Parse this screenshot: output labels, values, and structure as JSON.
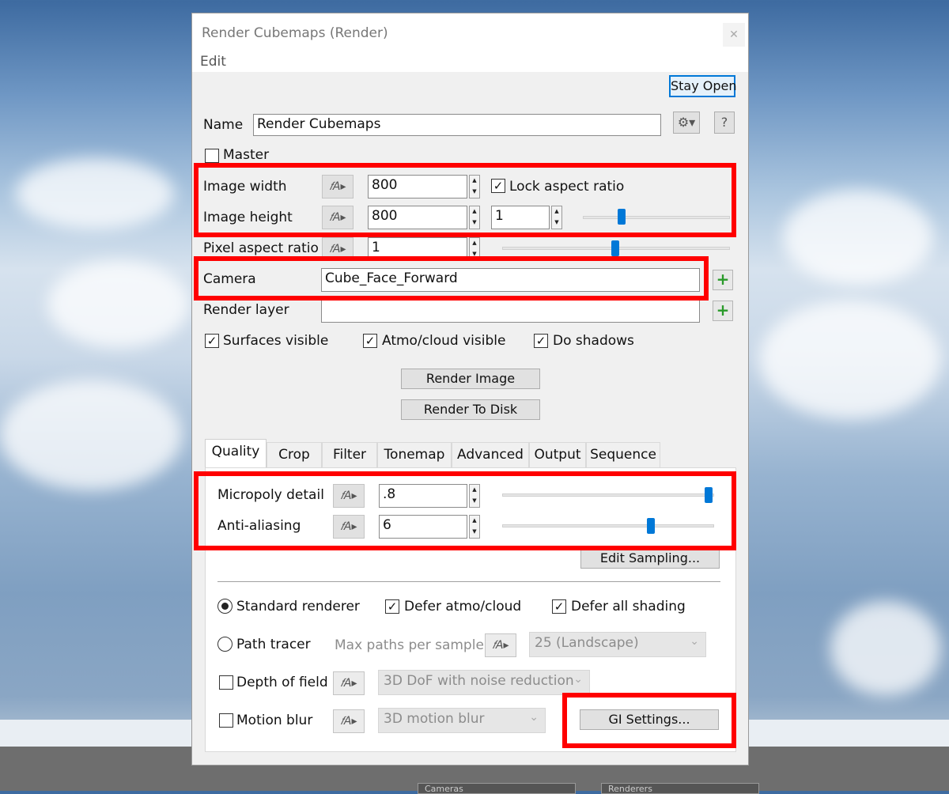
{
  "window": {
    "title": "Render Cubemaps    (Render)",
    "menu_edit": "Edit",
    "close_glyph": "✕"
  },
  "toolbar": {
    "stay_open": "Stay Open",
    "gear_glyph": "⚙▾",
    "help": "?"
  },
  "name": {
    "label": "Name",
    "value": "Render Cubemaps"
  },
  "master": {
    "label": "Master",
    "checked": false
  },
  "image_width": {
    "label": "Image width",
    "value": "800"
  },
  "lock_aspect": {
    "label": "Lock aspect ratio",
    "checked": true
  },
  "image_height": {
    "label": "Image height",
    "value": "800",
    "ratio_value": "1"
  },
  "pixel_aspect": {
    "label": "Pixel aspect ratio",
    "value": "1"
  },
  "camera": {
    "label": "Camera",
    "value": "Cube_Face_Forward"
  },
  "render_layer": {
    "label": "Render layer",
    "value": ""
  },
  "visibility": {
    "surfaces": {
      "label": "Surfaces visible",
      "checked": true
    },
    "atmo": {
      "label": "Atmo/cloud visible",
      "checked": true
    },
    "shadows": {
      "label": "Do shadows",
      "checked": true
    }
  },
  "buttons": {
    "render_image": "Render Image",
    "render_to_disk": "Render To Disk",
    "edit_sampling": "Edit Sampling...",
    "gi_settings": "GI Settings..."
  },
  "tabs": [
    "Quality",
    "Crop",
    "Filter",
    "Tonemap",
    "Advanced",
    "Output",
    "Sequence"
  ],
  "quality": {
    "micropoly": {
      "label": "Micropoly detail",
      "value": ".8"
    },
    "antialiasing": {
      "label": "Anti-aliasing",
      "value": "6"
    },
    "standard_renderer": {
      "label": "Standard renderer",
      "selected": true
    },
    "defer_atmo": {
      "label": "Defer atmo/cloud",
      "checked": true
    },
    "defer_shading": {
      "label": "Defer all shading",
      "checked": true
    },
    "path_tracer": {
      "label": "Path tracer",
      "selected": false
    },
    "max_paths": {
      "label": "Max paths per sample",
      "value": "25 (Landscape)"
    },
    "dof": {
      "label": "Depth of field",
      "value": "3D DoF with noise reduction",
      "checked": false
    },
    "motion_blur": {
      "label": "Motion blur",
      "value": "3D motion blur",
      "checked": false
    }
  },
  "icons": {
    "anim": "𝑓A▸",
    "check": "✓",
    "up": "▲",
    "down": "▼",
    "chevron": "⌄",
    "plus": "+"
  },
  "background_tabs": [
    "Cameras",
    "Renderers"
  ],
  "colors": {
    "highlight": "#ff0000",
    "slider": "#0078d7"
  }
}
